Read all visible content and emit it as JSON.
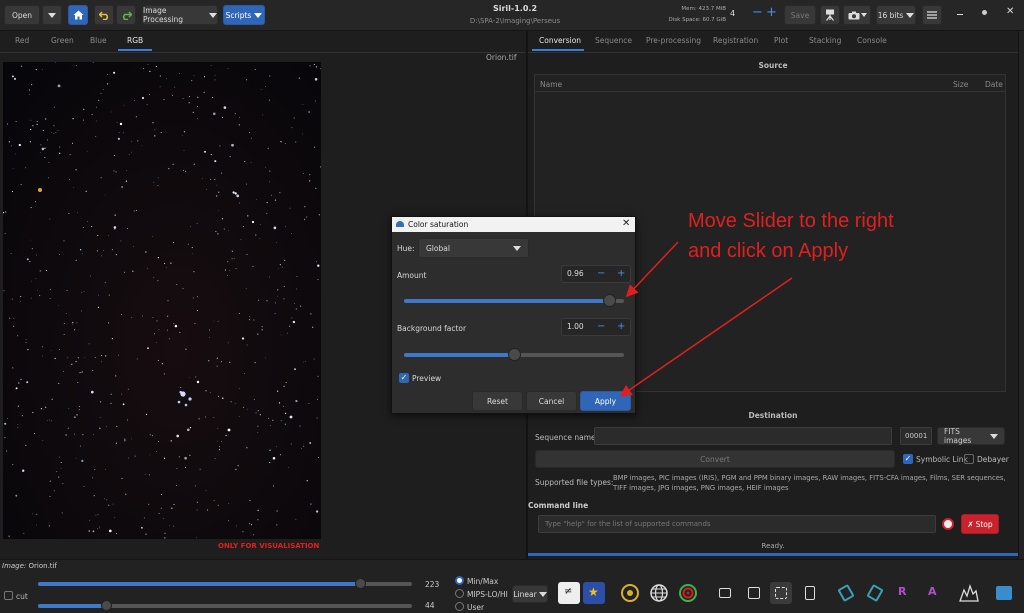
{
  "window": {
    "title": "Siril-1.0.2",
    "path": "D:\\SPA-2\\Imaging\\Perseus"
  },
  "toolbar": {
    "open_label": "Open",
    "image_processing_label": "Image Processing",
    "scripts_label": "Scripts",
    "mem": "Mem: 423.7 MiB",
    "disk": "Disk Space: 60.7 GiB",
    "threads": "4",
    "save_label": "Save",
    "bits": "16 bits"
  },
  "left_tabs": [
    "Red",
    "Green",
    "Blue",
    "RGB"
  ],
  "image": {
    "filename": "Orion.tif",
    "watermark": "ONLY FOR VISUALISATION"
  },
  "right_tabs": [
    "Conversion",
    "Sequence",
    "Pre-processing",
    "Registration",
    "Plot",
    "Stacking",
    "Console"
  ],
  "source": {
    "title": "Source",
    "col_name": "Name",
    "col_size": "Size",
    "col_date": "Date"
  },
  "destination": {
    "title": "Destination",
    "seq_label": "Sequence name:",
    "index": "00001",
    "format": "FITS images",
    "convert_label": "Convert",
    "symbolic_label": "Symbolic Link",
    "debayer_label": "Debayer",
    "supported_label": "Supported file types:",
    "supported_text": "BMP images, PIC images (IRIS), PGM and PPM binary images, RAW images, FITS-CFA images, Films, SER sequences, TIFF images, JPG images, PNG images, HEIF images"
  },
  "command": {
    "title": "Command line",
    "placeholder": "Type \"help\" for the list of supported commands",
    "stop_label": "Stop",
    "status": "Ready."
  },
  "dialog": {
    "title": "Color saturation",
    "hue_label": "Hue:",
    "hue_value": "Global",
    "amount_label": "Amount",
    "amount_value": "0.96",
    "amount_level": 0.96,
    "bg_label": "Background factor",
    "bg_value": "1.00",
    "bg_level": 0.5,
    "preview_label": "Preview",
    "reset_label": "Reset",
    "cancel_label": "Cancel",
    "apply_label": "Apply"
  },
  "annotation": {
    "line1": "Move Slider to the right",
    "line2": "and click on Apply",
    "color": "#e02020"
  },
  "bottom": {
    "image_label": "Image:",
    "image_name": "Orion.tif",
    "high_value": "223",
    "low_value": "44",
    "cut_label": "cut",
    "modes": [
      "Min/Max",
      "MIPS-LO/HI",
      "User"
    ],
    "scale": "Linear"
  },
  "colors": {
    "accent": "#2f66b8",
    "stop": "#c8232c"
  }
}
